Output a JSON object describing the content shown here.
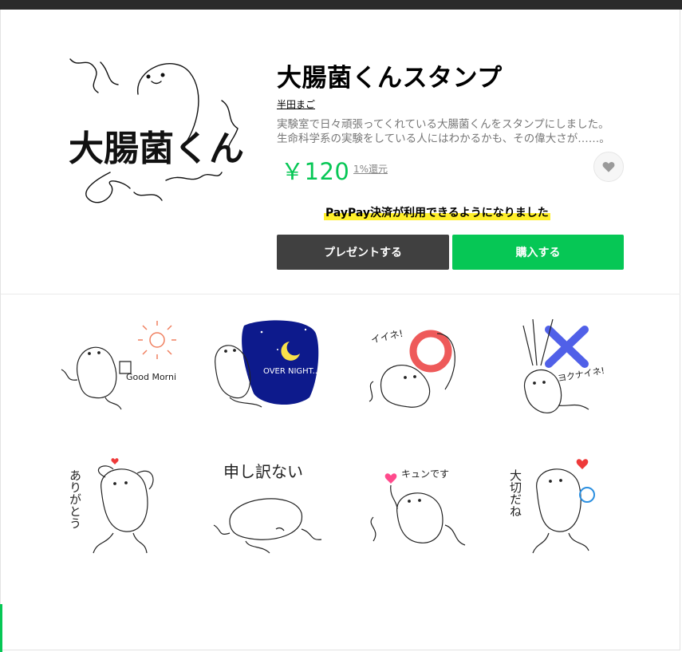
{
  "product": {
    "title": "大腸菌くんスタンプ",
    "author": "半田まご",
    "description_line1": "実験室で日々頑張ってくれている大腸菌くんをスタンプにしました。",
    "description_line2": "生命科学系の実験をしている人にはわかるかも、その偉大さが……。",
    "price": "￥120",
    "points": "1%還元",
    "main_image_text": "大腸菌くん"
  },
  "notice": {
    "paypay": "PayPay決済が利用できるようになりました"
  },
  "buttons": {
    "gift": "プレゼントする",
    "buy": "購入する"
  },
  "stickers": [
    {
      "name": "good-morning",
      "text": "Good Morning"
    },
    {
      "name": "over-night",
      "text": "OVER NIGHT..."
    },
    {
      "name": "iine",
      "text": "イイネ!"
    },
    {
      "name": "yokunaine",
      "text": "ヨクナイネ!"
    },
    {
      "name": "arigatou",
      "text": "ありがとう"
    },
    {
      "name": "moushiwakenai",
      "text": "申し訳ない"
    },
    {
      "name": "kyun",
      "text": "キュンです"
    },
    {
      "name": "taisetsu",
      "text": "大切だね"
    }
  ],
  "colors": {
    "accent": "#06c755",
    "gift_button": "#404040",
    "highlight": "#ffef2a"
  }
}
